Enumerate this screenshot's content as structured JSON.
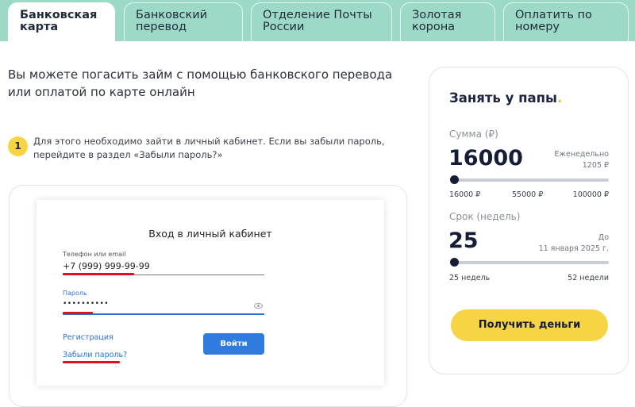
{
  "tabs": [
    {
      "line1": "Банковская",
      "line2": "карта",
      "active": true
    },
    {
      "line1": "Банковский",
      "line2": "перевод",
      "active": false
    },
    {
      "line1": "Отделение Почты",
      "line2": "России",
      "active": false
    },
    {
      "line1": "Золотая",
      "line2": "корона",
      "active": false
    },
    {
      "line1": "Оплатить по",
      "line2": "номеру",
      "active": false
    }
  ],
  "lead_text": "Вы можете погасить займ с помощью банковского перевода или оплатой по карте онлайн",
  "step": {
    "number": "1",
    "text": "Для этого необходимо зайти в личный кабинет. Если вы забыли пароль, перейдите в раздел «Забыли пароль?»"
  },
  "login": {
    "title": "Вход в личный кабинет",
    "phone_label": "Телефон или email",
    "phone_value": "+7 (999) 999-99-99",
    "password_label": "Пароль",
    "password_value": "••••••••••",
    "register_link": "Регистрация",
    "forgot_link": "Забыли пароль?",
    "login_button": "Войти"
  },
  "calculator": {
    "title": "Занять у папы",
    "title_dot": ".",
    "amount_label": "Сумма (₽)",
    "amount_value": "16000",
    "amount_note_line1": "Еженедельно",
    "amount_note_line2": "1205 ₽",
    "amount_slider_fraction": 0.0,
    "amount_ticks": [
      "16000 ₽",
      "55000 ₽",
      "100000 ₽"
    ],
    "term_label": "Срок (недель)",
    "term_value": "25",
    "term_note_line1": "До",
    "term_note_line2": "11 января 2025 г.",
    "term_slider_fraction": 0.0,
    "term_ticks": [
      "25 недель",
      "52 недели"
    ],
    "cta": "Получить деньги"
  },
  "colors": {
    "tab_bar": "#9dd9c7",
    "accent_yellow": "#f6d443",
    "link_blue": "#2f6fd6",
    "highlight_red": "#e0111b",
    "dark_navy": "#151d36"
  }
}
